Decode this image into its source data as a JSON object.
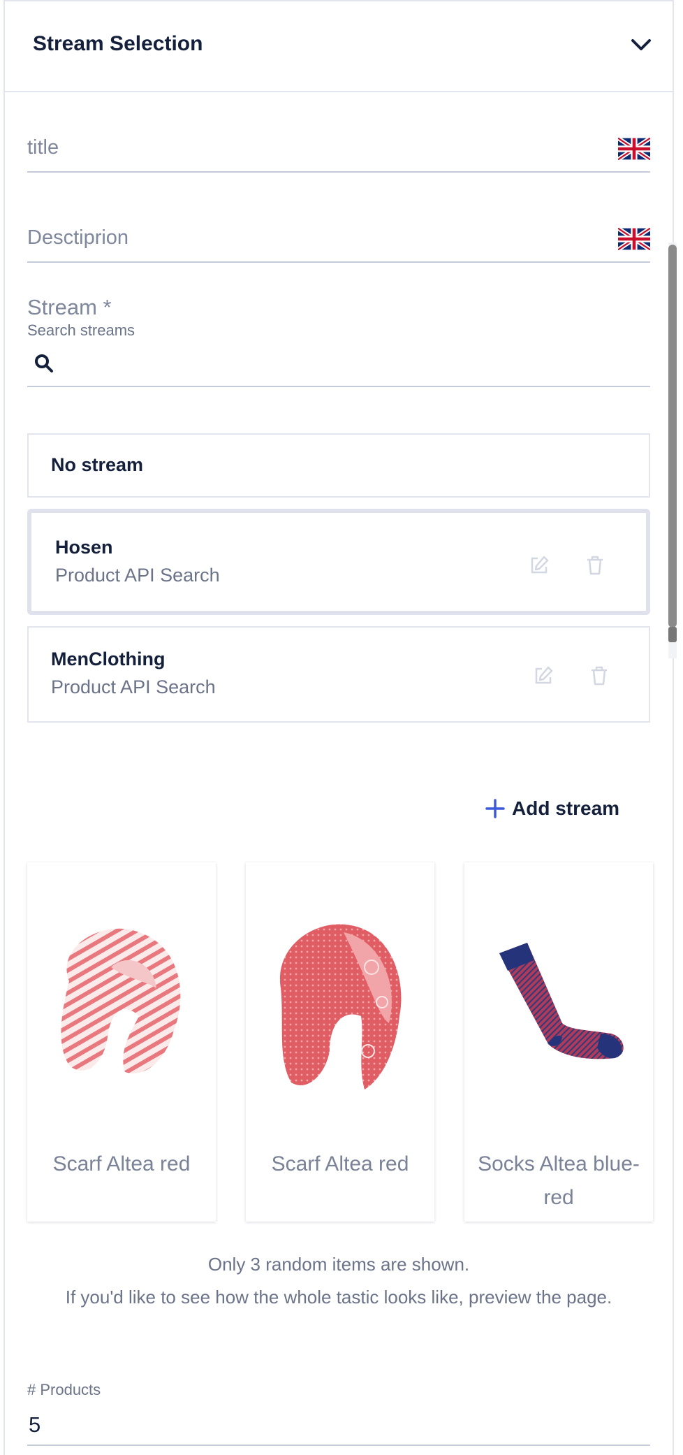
{
  "header": {
    "title": "Stream Selection",
    "toggle_icon": "chevron-down-icon"
  },
  "fields": {
    "title": {
      "placeholder": "title",
      "language_icon": "uk-flag-icon"
    },
    "description": {
      "placeholder": "Desctiprion",
      "language_icon": "uk-flag-icon"
    }
  },
  "stream": {
    "label": "Stream *",
    "search_label": "Search streams",
    "search_icon": "search-icon",
    "options": [
      {
        "title": "No stream",
        "subtitle": ""
      },
      {
        "title": "Hosen",
        "subtitle": "Product API Search",
        "selected": true
      },
      {
        "title": "MenClothing",
        "subtitle": "Product API Search"
      }
    ],
    "add_label": "Add stream"
  },
  "preview": {
    "products": [
      {
        "name": "Scarf Altea red",
        "image": "striped-scarf-image"
      },
      {
        "name": "Scarf Altea red",
        "image": "floral-scarf-image"
      },
      {
        "name": "Socks Altea blue-red",
        "image": "socks-image"
      }
    ],
    "note_line1": "Only 3 random items are shown.",
    "note_line2": "If you'd like to see how the whole tastic looks like, preview the page."
  },
  "products_count": {
    "label": "# Products",
    "value": "5"
  },
  "colors": {
    "accent": "#3b5bdb",
    "text_dark": "#14203b",
    "text_muted": "#7f879c",
    "border": "#e2e5ee"
  }
}
